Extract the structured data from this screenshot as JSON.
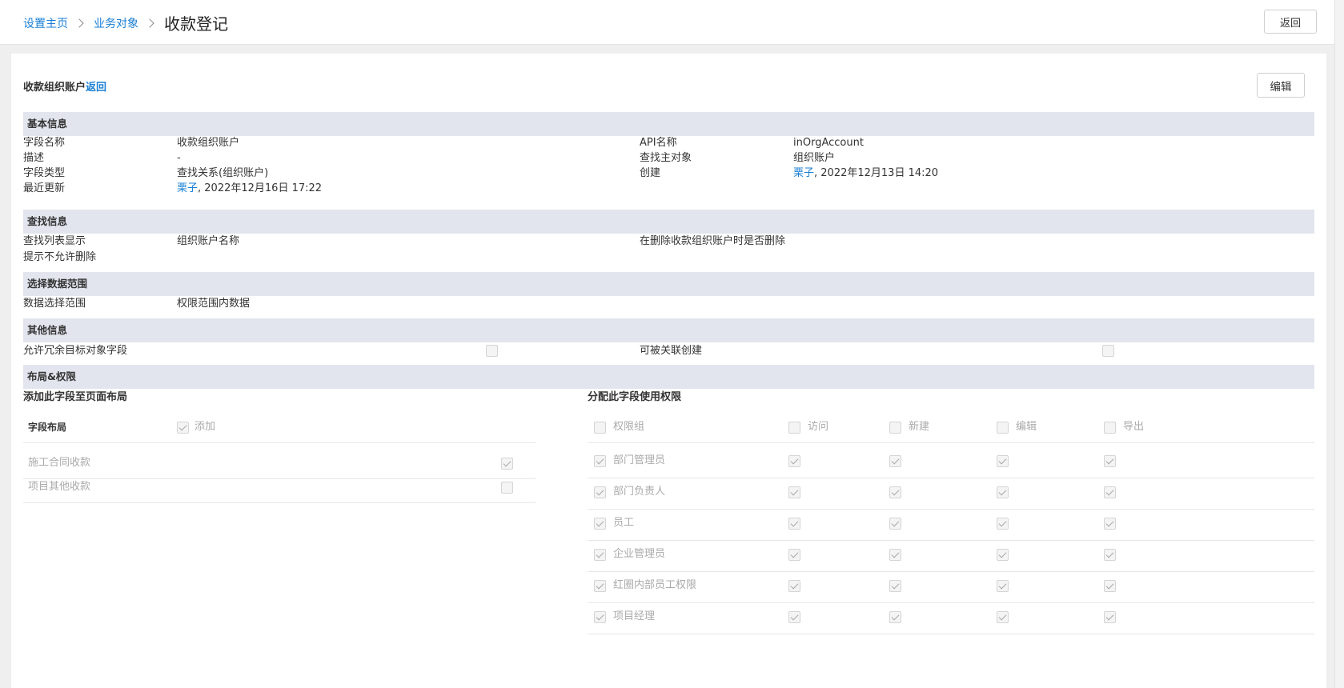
{
  "breadcrumb": {
    "home": "设置主页",
    "objects": "业务对象",
    "current": "收款登记"
  },
  "top_back_button": "返回",
  "field_title": "收款组织账户",
  "field_title_back": "返回",
  "edit_button": "编辑",
  "sections": {
    "basic": "基本信息",
    "lookup": "查找信息",
    "scope": "选择数据范围",
    "other": "其他信息",
    "layout": "布局&权限"
  },
  "basic": {
    "field_name_label": "字段名称",
    "field_name_value": "收款组织账户",
    "description_label": "描述",
    "description_value": "-",
    "field_type_label": "字段类型",
    "field_type_value": "查找关系(组织账户)",
    "last_update_label": "最近更新",
    "last_update_user": "栗子",
    "last_update_time": ", 2022年12月16日 17:22",
    "api_name_label": "API名称",
    "api_name_value": "inOrgAccount",
    "lookup_object_label": "查找主对象",
    "lookup_object_value": "组织账户",
    "created_label": "创建",
    "created_user": "栗子",
    "created_time": ", 2022年12月13日 14:20"
  },
  "lookup": {
    "list_display_label": "查找列表显示",
    "list_display_value": "组织账户名称",
    "delete_label": "在删除收款组织账户时是否删除",
    "delete_value": "提示不允许删除"
  },
  "scope": {
    "label": "数据选择范围",
    "value": "权限范围内数据"
  },
  "other": {
    "redundant_label": "允许冗余目标对象字段",
    "redundant_checked": false,
    "relation_create_label": "可被关联创建",
    "relation_create_checked": false
  },
  "layout": {
    "add_to_layout_title": "添加此字段至页面布局",
    "column_layout": "字段布局",
    "column_add": "添加",
    "layouts": [
      {
        "name": "施工合同收款",
        "checked": true
      },
      {
        "name": "项目其他收款",
        "checked": false
      }
    ]
  },
  "permissions": {
    "title": "分配此字段使用权限",
    "headers": [
      "权限组",
      "访问",
      "新建",
      "编辑",
      "导出"
    ],
    "rows": [
      {
        "name": "部门管理员",
        "visit": true,
        "create": true,
        "edit": true,
        "export": true
      },
      {
        "name": "部门负责人",
        "visit": true,
        "create": true,
        "edit": true,
        "export": true
      },
      {
        "name": "员工",
        "visit": true,
        "create": true,
        "edit": true,
        "export": true
      },
      {
        "name": "企业管理员",
        "visit": true,
        "create": true,
        "edit": true,
        "export": true
      },
      {
        "name": "红圈内部员工权限",
        "visit": true,
        "create": true,
        "edit": true,
        "export": true
      },
      {
        "name": "项目经理",
        "visit": true,
        "create": true,
        "edit": true,
        "export": true
      }
    ]
  },
  "colors": {
    "link": "#1a7fd4",
    "section_bg": "#e2e5ee",
    "page_bg": "#efefef"
  }
}
